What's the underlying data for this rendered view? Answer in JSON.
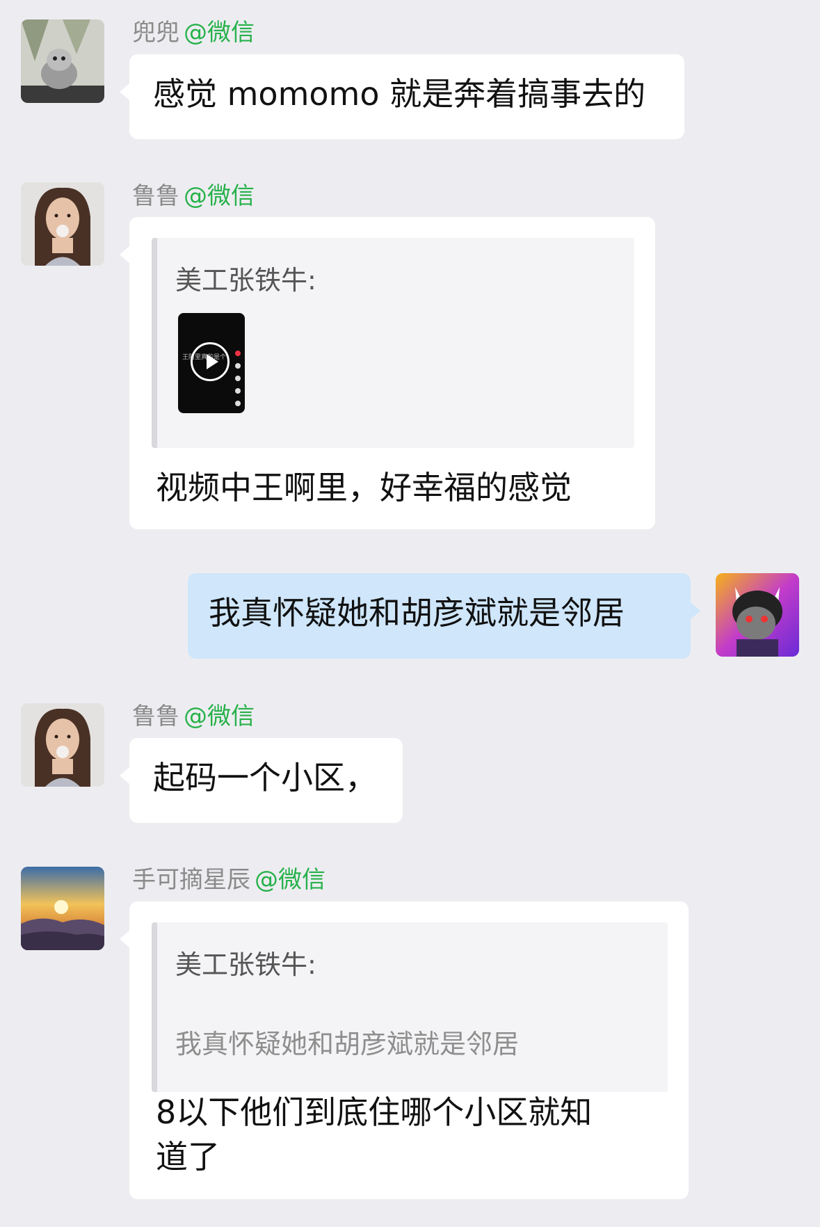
{
  "chat": {
    "via_label": "@微信",
    "messages": [
      {
        "sender": "兜兜",
        "avatar": "kitten-avatar",
        "text": "感觉 momomo 就是奔着搞事去的"
      },
      {
        "sender": "鲁鲁",
        "avatar": "woman-bubblegum-avatar",
        "quote": {
          "name": "美工张铁牛:",
          "media": "video-thumbnail",
          "media_caption": "王阿里真的是个"
        },
        "text": "视频中王啊里，好幸福的感觉"
      },
      {
        "sender": "me",
        "avatar": "cartoon-goat-avatar",
        "text": "我真怀疑她和胡彦斌就是邻居"
      },
      {
        "sender": "鲁鲁",
        "avatar": "woman-bubblegum-avatar",
        "text": "起码一个小区，"
      },
      {
        "sender": "手可摘星辰",
        "avatar": "sunset-avatar",
        "quote": {
          "name": "美工张铁牛:",
          "text": "我真怀疑她和胡彦斌就是邻居"
        },
        "text_line1": "8以下他们到底住哪个小区就知",
        "text_line2": "道了"
      }
    ]
  },
  "colors": {
    "background": "#ededf1",
    "bubble_incoming": "#ffffff",
    "bubble_outgoing": "#cfe6fb",
    "via_green": "#27b14a",
    "sender_gray": "#8a8a8a"
  }
}
